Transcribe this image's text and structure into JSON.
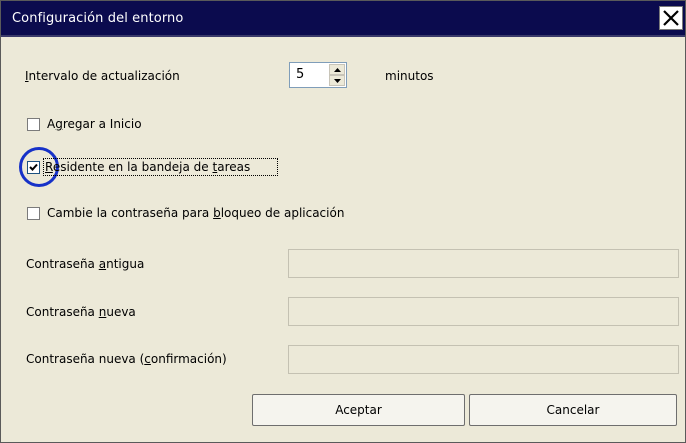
{
  "window": {
    "title": "Configuración del entorno"
  },
  "update_interval": {
    "label_prefix": "I",
    "label_rest": "ntervalo de actualización",
    "value": "5",
    "unit": "minutos"
  },
  "checkboxes": [
    {
      "id": "add-to-start",
      "label_prefix": "A",
      "label_u": "g",
      "label_rest": "regar a Inicio",
      "checked": false
    },
    {
      "id": "resident-tray",
      "label_prefix": "",
      "label_u": "R",
      "label_mid": "esidente en la bandeja de ",
      "label_u2": "t",
      "label_rest": "areas",
      "checked": true
    },
    {
      "id": "change-password",
      "label_prefix": "Cambie la contraseña para ",
      "label_u": "b",
      "label_rest": "loqueo de aplicación",
      "checked": false
    }
  ],
  "fields": {
    "old_password": {
      "label_prefix": "Contraseña ",
      "label_u": "a",
      "label_rest": "ntigua",
      "value": ""
    },
    "new_password": {
      "label_prefix": "Contraseña ",
      "label_u": "n",
      "label_rest": "ueva",
      "value": ""
    },
    "confirm_password": {
      "label_prefix": "Contraseña nueva (",
      "label_u": "c",
      "label_rest": "onfirmación)",
      "value": ""
    }
  },
  "buttons": {
    "ok": "Aceptar",
    "cancel": "Cancelar"
  },
  "icons": {
    "close": "close-icon",
    "spin_up": "triangle-up-icon",
    "spin_down": "triangle-down-icon",
    "check": "check-mark-icon"
  },
  "colors": {
    "titlebar": "#0b0b4e",
    "dialog_bg": "#ece9d8",
    "highlight_ring": "#1631c8"
  }
}
